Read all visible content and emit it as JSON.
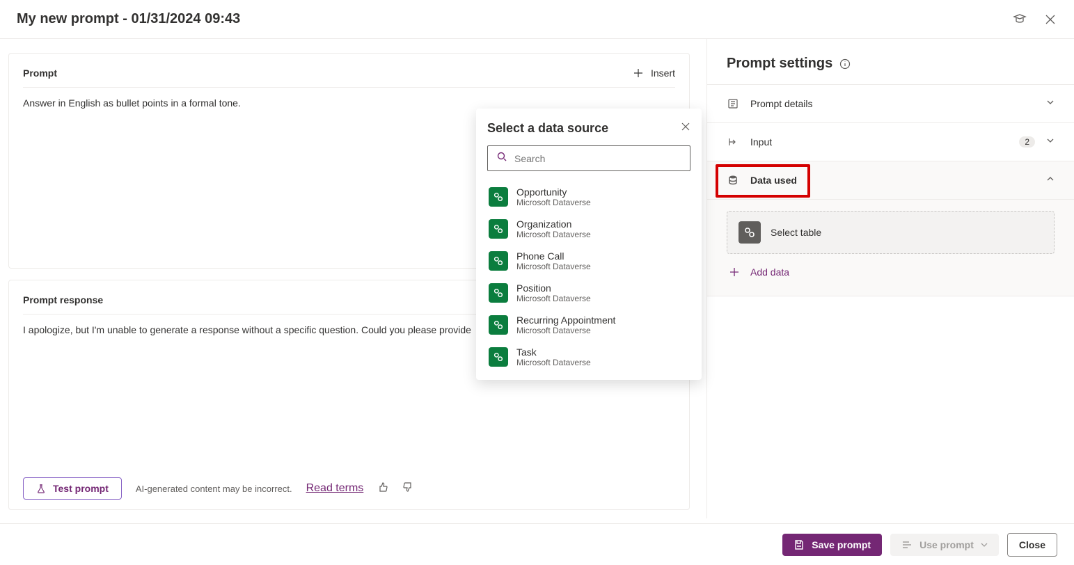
{
  "header": {
    "title": "My new prompt - 01/31/2024 09:43"
  },
  "prompt_card": {
    "title": "Prompt",
    "insert_label": "Insert",
    "text": "Answer in English as bullet points in a formal tone."
  },
  "response_card": {
    "title": "Prompt response",
    "text": "I apologize, but I'm unable to generate a response without a specific question. Could you please provide",
    "test_label": "Test prompt",
    "disclaimer": "AI-generated content may be incorrect.",
    "read_terms": "Read terms"
  },
  "settings": {
    "title": "Prompt settings",
    "items": {
      "details": "Prompt details",
      "input": "Input",
      "input_badge": "2",
      "data_used": "Data used"
    },
    "select_table": "Select table",
    "add_data": "Add data"
  },
  "popup": {
    "title": "Select a data source",
    "search_placeholder": "Search",
    "items": [
      {
        "name": "Opportunity",
        "sub": "Microsoft Dataverse"
      },
      {
        "name": "Organization",
        "sub": "Microsoft Dataverse"
      },
      {
        "name": "Phone Call",
        "sub": "Microsoft Dataverse"
      },
      {
        "name": "Position",
        "sub": "Microsoft Dataverse"
      },
      {
        "name": "Recurring Appointment",
        "sub": "Microsoft Dataverse"
      },
      {
        "name": "Task",
        "sub": "Microsoft Dataverse"
      }
    ]
  },
  "footer": {
    "save": "Save prompt",
    "use": "Use prompt",
    "close": "Close"
  }
}
